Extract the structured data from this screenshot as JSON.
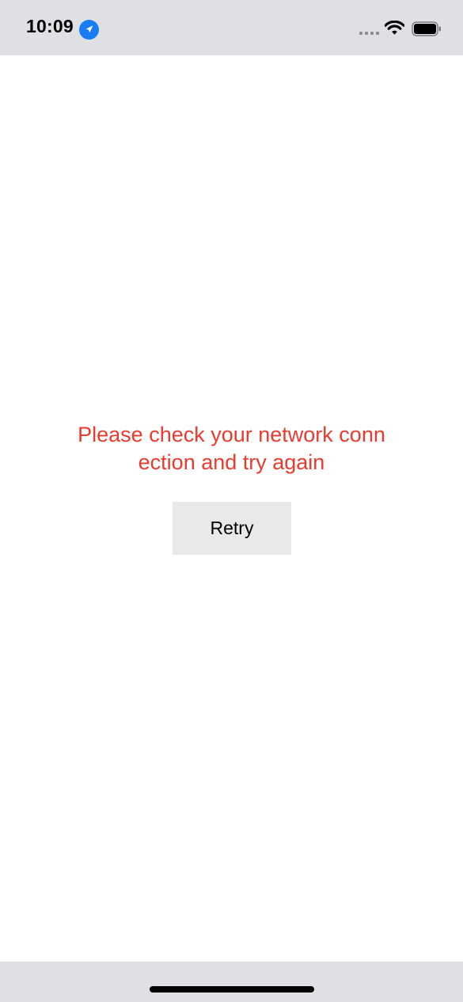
{
  "status_bar": {
    "time": "10:09",
    "location_icon": "location-arrow-icon",
    "signal_icon": "cellular-signal-icon",
    "wifi_icon": "wifi-icon",
    "battery_icon": "battery-icon",
    "accent_color": "#1a7cf5"
  },
  "main": {
    "error_message": "Please check your network conn ection and try again",
    "error_color": "#ec3a2f",
    "retry_label": "Retry"
  },
  "home_indicator": {
    "icon": "home-indicator-bar"
  }
}
